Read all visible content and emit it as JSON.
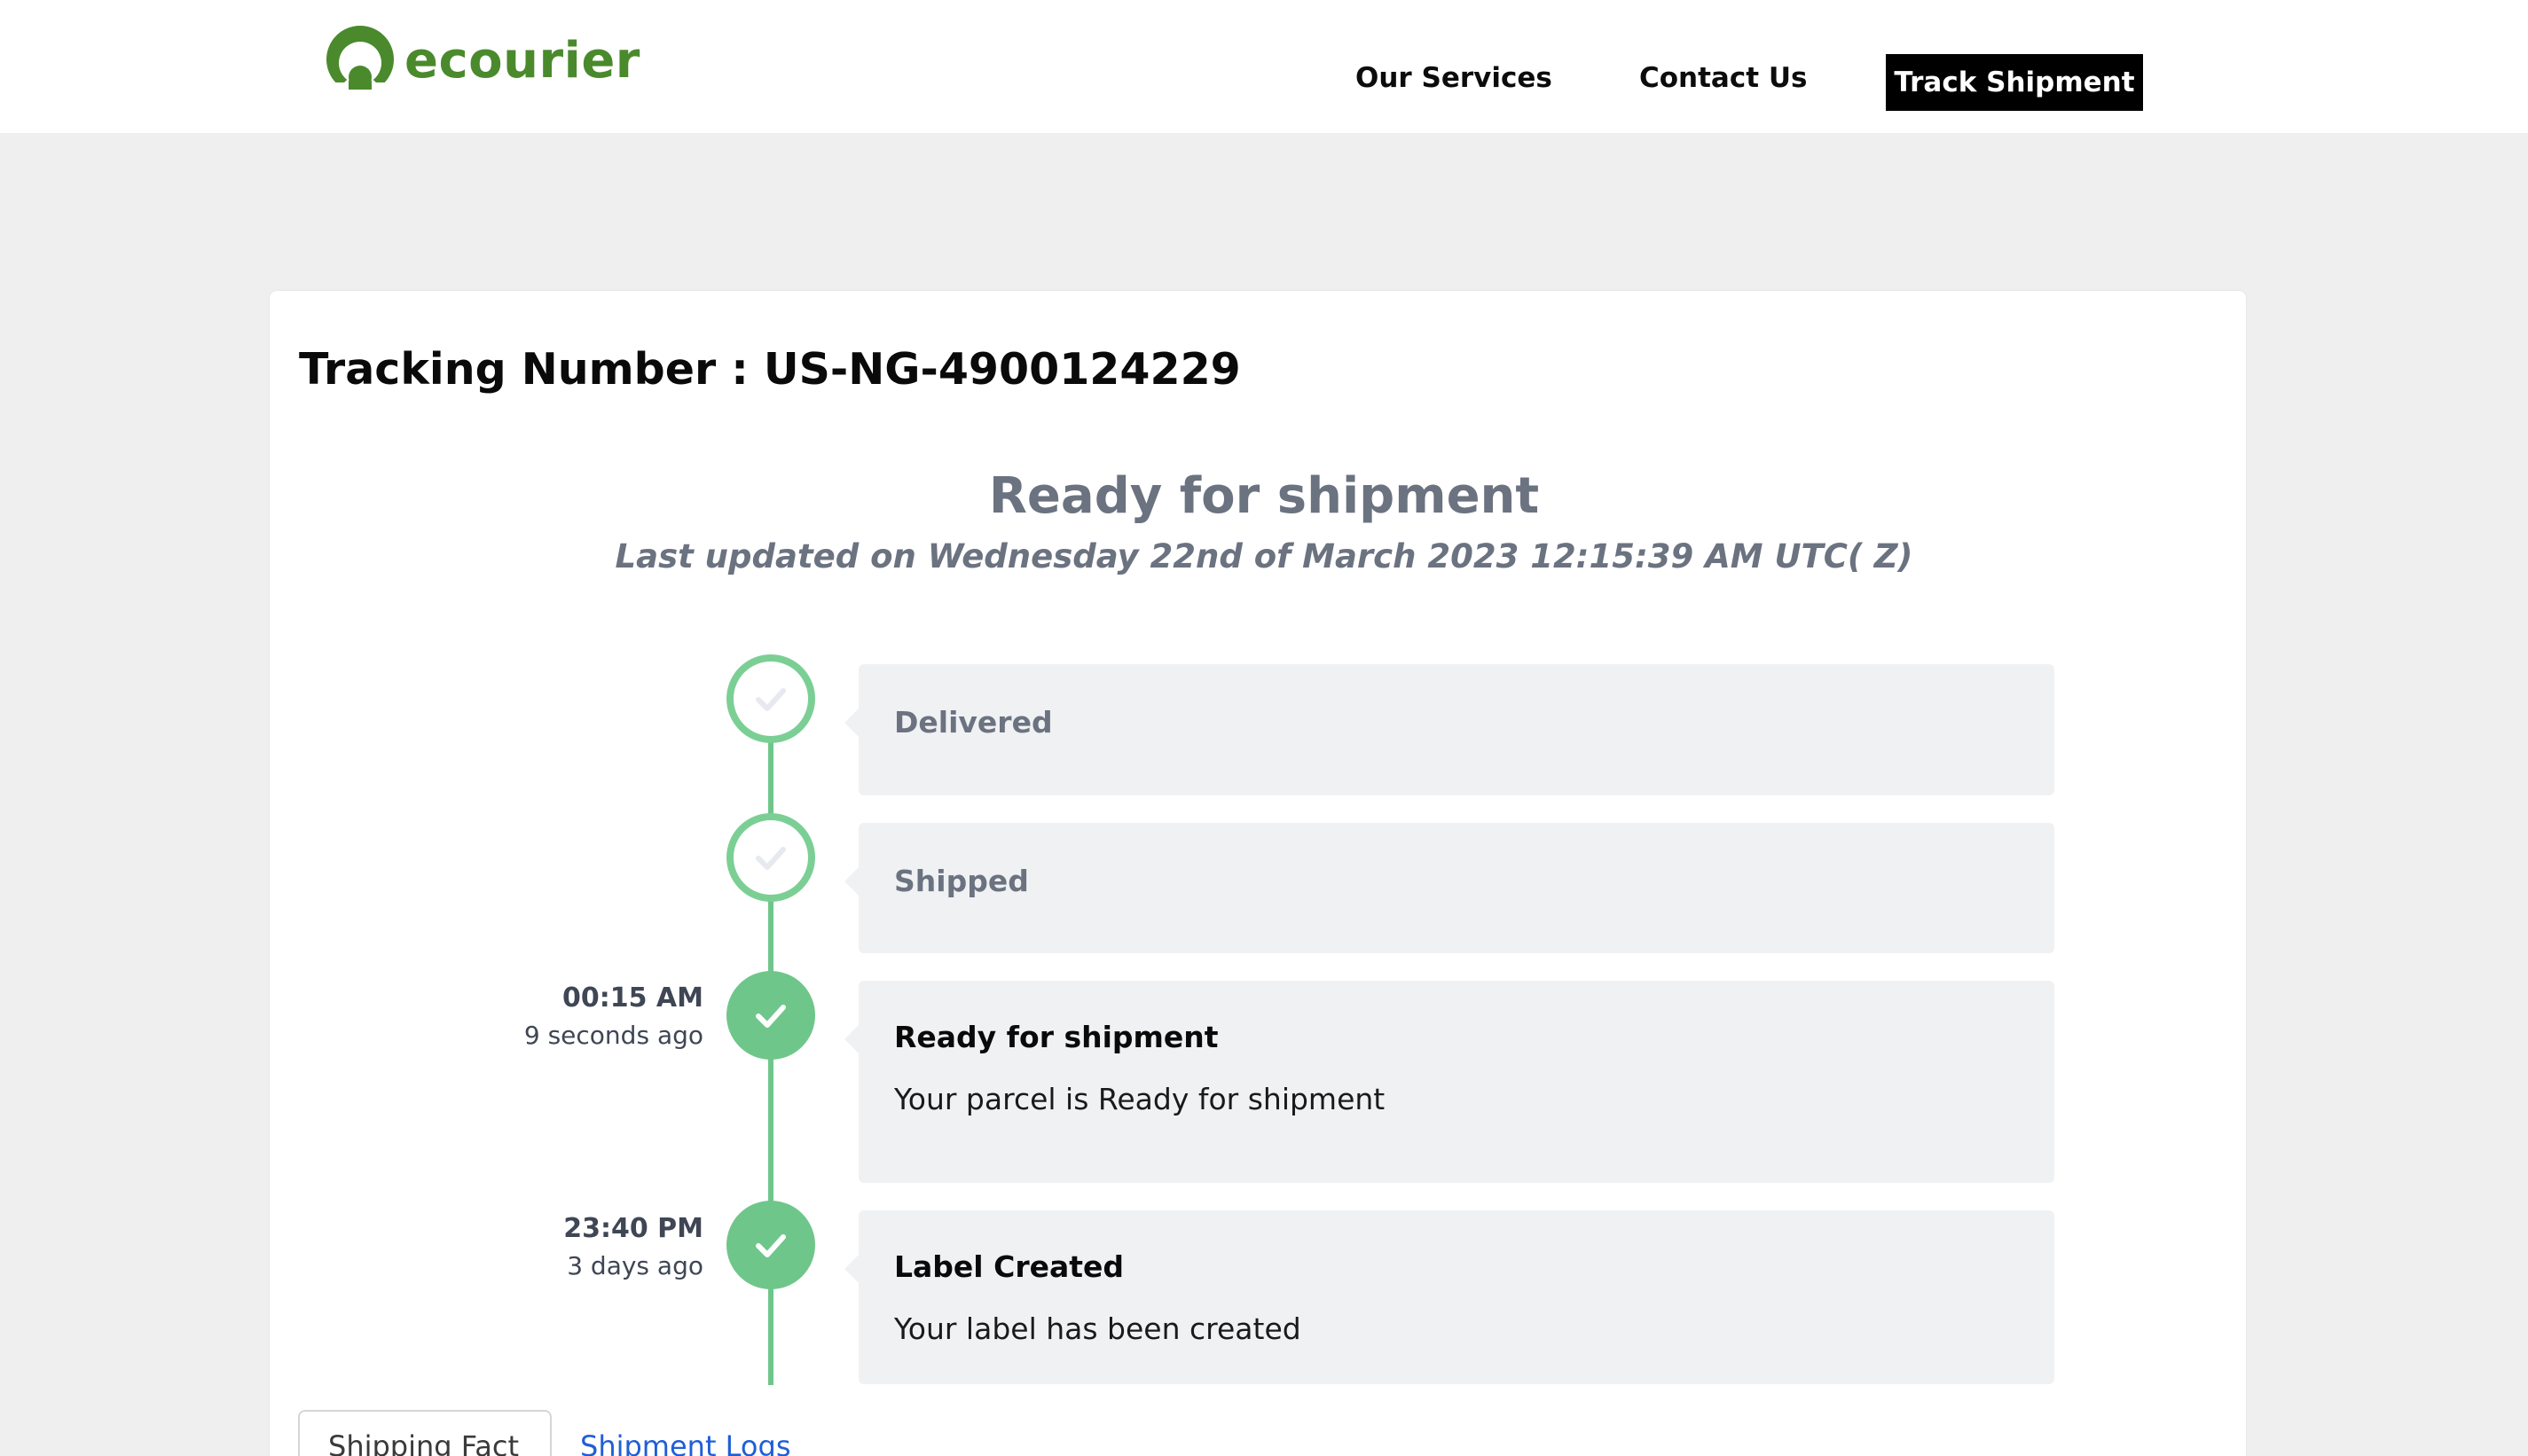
{
  "header": {
    "logo_text": "ecourier",
    "nav": {
      "services": "Our Services",
      "contact": "Contact Us",
      "track": "Track Shipment"
    }
  },
  "tracking": {
    "title": "Tracking Number : US-NG-4900124229",
    "status": "Ready for shipment",
    "last_updated": "Last updated on Wednesday 22nd of March 2023 12:15:39 AM UTC( Z)"
  },
  "timeline": [
    {
      "title": "Delivered",
      "state": "pending",
      "time": "",
      "ago": "",
      "description": ""
    },
    {
      "title": "Shipped",
      "state": "pending",
      "time": "",
      "ago": "",
      "description": ""
    },
    {
      "title": "Ready for shipment",
      "state": "done",
      "time": "00:15 AM",
      "ago": "9 seconds ago",
      "description": "Your parcel is Ready for shipment"
    },
    {
      "title": "Label Created",
      "state": "done",
      "time": "23:40 PM",
      "ago": "3 days ago",
      "description": "Your label has been created"
    }
  ],
  "tabs": {
    "fact": "Shipping Fact",
    "logs": "Shipment Logs"
  },
  "colors": {
    "brand": "#4a8a2c",
    "timeline": "#6fc68a",
    "link": "#1f5fd6"
  }
}
